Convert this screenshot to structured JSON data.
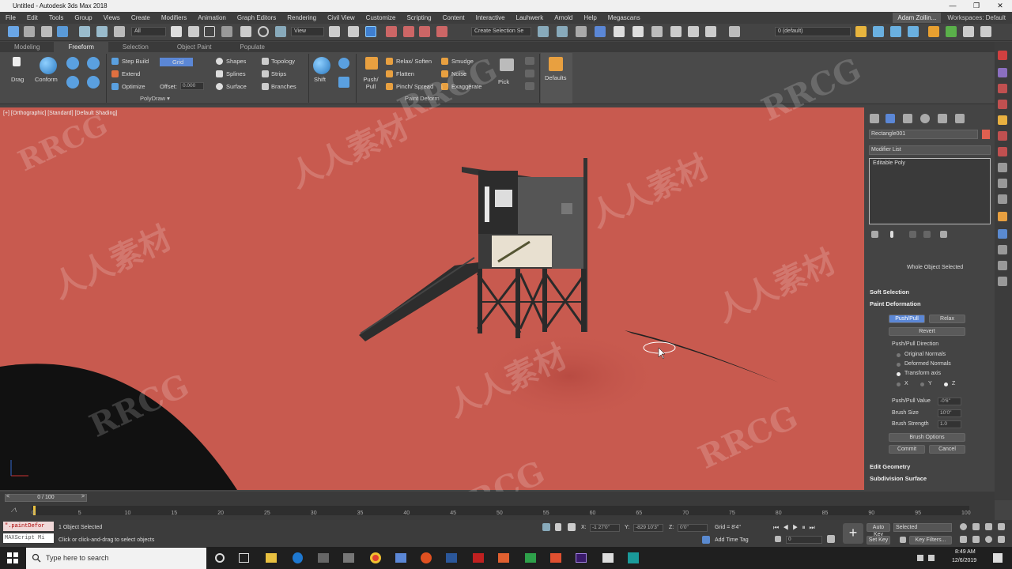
{
  "window": {
    "title": "Untitled - Autodesk 3ds Max 2018",
    "min": "—",
    "max": "❐",
    "close": "✕"
  },
  "menu": [
    "File",
    "Edit",
    "Tools",
    "Group",
    "Views",
    "Create",
    "Modifiers",
    "Animation",
    "Graph Editors",
    "Rendering",
    "Civil View",
    "Customize",
    "Scripting",
    "Content",
    "Interactive",
    "Lauhwerk",
    "Arnold",
    "Help",
    "Megascans"
  ],
  "user": "Adam Zollin...",
  "workspaces": "Workspaces: Default",
  "toolbar": {
    "filter": "All",
    "ref_coord": "View",
    "selection_set": "Create Selection Se",
    "layer": "0 (default)"
  },
  "ribbon_tabs": [
    "Modeling",
    "Freeform",
    "Selection",
    "Object Paint",
    "Populate"
  ],
  "ribbon": {
    "drag": "Drag",
    "conform": "Conform",
    "step_build": "Step Build",
    "extend": "Extend",
    "optimize": "Optimize",
    "grid": "Grid",
    "offset_label": "Offset:",
    "offset_value": "0.000",
    "shapes": "Shapes",
    "splines": "Splines",
    "surface": "Surface",
    "topology": "Topology",
    "strips": "Strips",
    "branches": "Branches",
    "polydraw": "PolyDraw ▾",
    "shift": "Shift",
    "push_pull": "Push/ Pull",
    "relax_soften": "Relax/ Soften",
    "flatten": "Flatten",
    "pinch_spread": "Pinch/ Spread",
    "smudge": "Smudge",
    "noise": "Noise",
    "exaggerate": "Exaggerate",
    "pick": "Pick",
    "paint_deform": "Paint Deform",
    "defaults": "Defaults"
  },
  "viewport_label": "[+] [Orthographic] [Standard] [Default Shading]",
  "panel": {
    "object_name": "Rectangle001",
    "modifier_list": "Modifier List",
    "stack_item": "Editable Poly",
    "whole_object": "Whole Object Selected",
    "soft_selection": "Soft Selection",
    "paint_deformation": "Paint Deformation",
    "push_pull": "Push/Pull",
    "relax": "Relax",
    "revert": "Revert",
    "direction": "Push/Pull Direction",
    "original_normals": "Original Normals",
    "deformed_normals": "Deformed Normals",
    "transform_axis": "Transform axis",
    "x": "X",
    "y": "Y",
    "z": "Z",
    "pp_value_label": "Push/Pull Value",
    "pp_value": "-0'6\"",
    "brush_size_label": "Brush Size",
    "brush_size": "10'0\"",
    "brush_strength_label": "Brush Strength",
    "brush_strength": "1.0",
    "brush_options": "Brush Options",
    "commit": "Commit",
    "cancel": "Cancel",
    "edit_geometry": "Edit Geometry",
    "subdivision_surface": "Subdivision Surface"
  },
  "timeline": {
    "frame": "0 / 100",
    "ticks": [
      "0",
      "5",
      "10",
      "15",
      "20",
      "25",
      "30",
      "35",
      "40",
      "45",
      "50",
      "55",
      "60",
      "65",
      "70",
      "75",
      "80",
      "85",
      "90",
      "95",
      "100"
    ]
  },
  "status": {
    "script1": "\".paintDefor",
    "script2": "MAXScript Mi",
    "selected": "1 Object Selected",
    "prompt": "Click or click-and-drag to select objects",
    "x_label": "X:",
    "x_val": "-1 27'0\"",
    "y_label": "Y:",
    "y_val": "-829 10'3\"",
    "z_label": "Z:",
    "z_val": "0'0\"",
    "grid": "Grid = 8'4\"",
    "add_time_tag": "Add Time Tag",
    "auto_key": "Auto Key",
    "set_key": "Set Key",
    "key_sel": "Selected",
    "key_filters": "Key Filters...",
    "frame_field": "0"
  },
  "taskbar": {
    "search": "Type here to search",
    "time": "8:49 AM",
    "date": "12/6/2019"
  },
  "watermarks": [
    "RRCG",
    "人人素材",
    "RRCG",
    "人人素材",
    "RRCG",
    "人人素材",
    "RRCG",
    "人人素材",
    "RRCG",
    "人人素材",
    "RRCG"
  ]
}
